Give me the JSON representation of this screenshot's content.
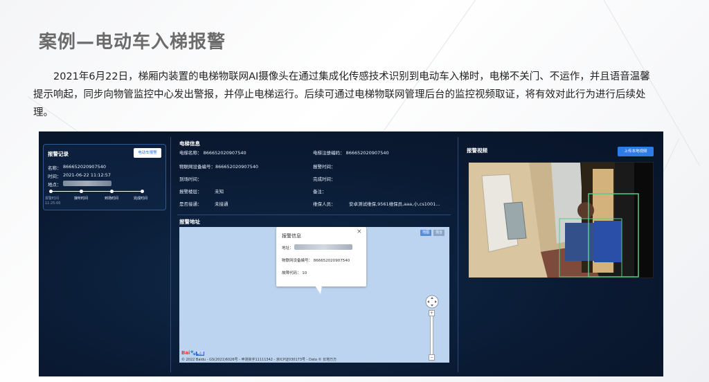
{
  "slide": {
    "title": "案例—电动车入梯报警",
    "paragraph": "2021年6月22日，梯厢内装置的电梯物联网AI摄像头在通过集成化传感技术识别到电动车入梯时，电梯不关门、不运作，并且语音温馨提示响起，同步向物管监控中心发出警报，并停止电梯运行。后续可通过电梯物联网管理后台的监控视频取证，将有效对此行为进行后续处理。"
  },
  "record": {
    "header": "报警记录",
    "button": "电动车报警",
    "name_label": "名称：",
    "name_value": "866652020907540",
    "time_label": "时间：",
    "time_value": "2021-06-22  11:12:57",
    "addr_label": "地点：",
    "steps": [
      "报警时间",
      "接听时间",
      "到场时间",
      "完成时间"
    ],
    "step_time": "11:25:00"
  },
  "elevator": {
    "header": "电梯信息",
    "name": "电梯名称：  866652020907540",
    "reg_code": "电梯注册编码：  866652020907540",
    "iot_code": "物联网设备编号：866652020907540",
    "alarm_time": "报警时间：",
    "arrive_time": "到场时间：",
    "finish_time": "完成时间：",
    "floor_label": "报警楼层：",
    "floor_value": "未知",
    "remark": "备注：",
    "connected_label": "是否接通：",
    "connected_value": "未接通",
    "maint_label": "维保人员：",
    "maint_value": "安卓测试维保,9561维保员,aaa,小,cs1001..."
  },
  "address": {
    "header": "报警地址",
    "popup_title": "报警信息",
    "popup_close": "×",
    "popup_addr": "地址：",
    "popup_iot": "物联网设备编号：  866652020907540",
    "popup_fault": "故障代码：  10",
    "map_types": [
      "地图",
      "混合"
    ],
    "baidu": "Bai",
    "baidu_map": "地图",
    "copyright": "© 2022 Baidu - GS(2021)6026号 - 甲测资字11111342 - 京ICP证030173号 - Data © 长地万方"
  },
  "video": {
    "header": "报警视频",
    "button": "上传本地视频"
  },
  "colors": {
    "screen_bg": "#0a1a33",
    "accent": "#2f7be8",
    "map_bg": "#bcd4ef"
  }
}
